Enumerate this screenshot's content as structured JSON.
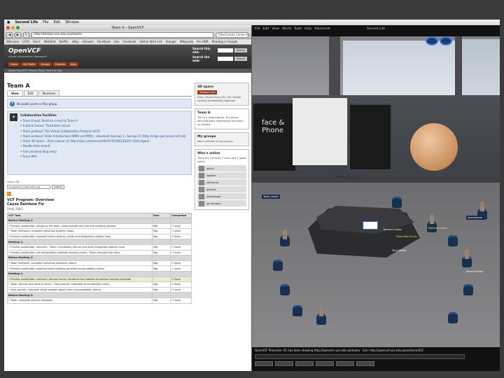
{
  "mac_menu": {
    "app": "Second Life",
    "items": [
      "File",
      "Edit",
      "Window"
    ]
  },
  "browser": {
    "title": "Team A - OpenVCF",
    "url": "http://telstar.ucs.edu.au/team/...",
    "search": "Vital Events Center for iPhoto",
    "bookmarks": [
      "Welcome",
      "LSTA",
      "Sonic",
      "WebStat",
      "Netflix",
      "eBay",
      "Amazon",
      "FaceBook",
      "Zoo",
      "Facebook",
      "Add to Wish List",
      "iGoogle",
      "Wikipedia",
      "Pro HDR",
      "Reading in Google"
    ]
  },
  "site": {
    "logo": "OpenVCF",
    "logo_sub": "virtual collaboration framework",
    "search_site_label": "Search this site:",
    "search_web_label": "Search the web:",
    "search_button": "Search",
    "nav": [
      "Home",
      "My Profile",
      "Groups",
      "Projects",
      "Help"
    ],
    "breadcrumb": "About OpenVCF   Privacy Policy   Terms of Use"
  },
  "page": {
    "title": "Team A",
    "tabs": [
      "View",
      "Edit",
      "Revisions"
    ],
    "notice": "No public posts in this group.",
    "tools_title": "Collaboration Facilities",
    "tools": [
      "Team E-mail: Send an e-mail to Team A",
      "Cultural Issues: Translation Issues",
      "Team protocol: The Virtual Collaboration Protocol (VCP)",
      "Team protocol: Video Introduction (WMV and MP4) - download (backup 1 , backup 2) (http://origin-ger-server.vcf.net)",
      "Team 3D Space - Zone (owner id: http://slurl.com/secondlife/VCF/128/128/25) (Visit Again)",
      "Doodle Polls (meet)",
      "Fast personal blog entry",
      "Team Wiki"
    ],
    "attach_label": "Attach file",
    "attach_value": "Unregistered collaboration.jpg",
    "attach_button": "Submit",
    "program_title": "VCF Program: Overview",
    "program_subtitle": "Cause Rainbow Fix",
    "program_link": "[Help, Edit]",
    "table_headers": [
      "VCF Task",
      "Role",
      "Completed"
    ],
    "rows": [
      {
        "type": "section",
        "task": "Before Meeting 1:",
        "role": "",
        "done": ""
      },
      {
        "type": "row",
        "task": "• Process coordinator: Introduce the team, communicate and plan the meeting process",
        "role": "Mgr",
        "done": "☐ done"
      },
      {
        "type": "row",
        "task": "• Team members: complete individual problem maps",
        "role": "Mgr",
        "done": "☐ done"
      },
      {
        "type": "row",
        "task": "• Process coordinator: organize team meeting; create and integrated problem map",
        "role": "Mgr",
        "done": "☐ done"
      },
      {
        "type": "section",
        "task": "Meeting 1:",
        "role": "",
        "done": ""
      },
      {
        "type": "row",
        "task": "• Process coordinator: welcome · Team: individually discuss and write integrated problem map",
        "role": "Mgr",
        "done": "☐ done"
      },
      {
        "type": "row",
        "task": "• Process coordinator: set deliverables; establish process norms · Team: allocate task roles",
        "role": "Mgr",
        "done": "☐ done"
      },
      {
        "type": "section",
        "task": "Before Meeting 2:",
        "role": "",
        "done": ""
      },
      {
        "type": "row",
        "task": "• Team members: complete individual tolerance matrix",
        "role": "Mgr",
        "done": "☐ done"
      },
      {
        "type": "row",
        "task": "• Process coordinator: organize team meeting; generate accountability matrix",
        "role": "Mgr",
        "done": "☐ done"
      },
      {
        "type": "section",
        "task": "Meeting 2:",
        "role": "",
        "done": ""
      },
      {
        "type": "hl",
        "task": "• Process coordinator: welcome; discuss norms; introduce the problem dimension solution template",
        "role": "-",
        "done": "☐ done"
      },
      {
        "type": "row",
        "task": "• Team: discuss and come to terms · Goal planner: complete accountability matrix",
        "role": "Mgr",
        "done": "☐ done"
      },
      {
        "type": "row",
        "task": "• Goal planner: complete single solution paper (from accountability matrix)",
        "role": "Mgr",
        "done": "☐ done"
      },
      {
        "type": "section",
        "task": "Before Meeting 3:",
        "role": "",
        "done": ""
      },
      {
        "type": "row",
        "task": "• Team: complete solution template",
        "role": "Mgr",
        "done": "☐ done"
      }
    ]
  },
  "sidebar": {
    "space_title": "3D space",
    "space_button": "Teleport now",
    "space_text": "Enter Virtual Zone (2D / 3D / Avatar lockers) (embedded) (optional)",
    "team_title": "Team A",
    "team_text": "This is a closed group. The group administrators add/remove members as needed.",
    "groups_title": "My groups",
    "groups_text": "Not a member of any groups.",
    "online_title": "Who's online",
    "online_text": "There are currently 2 users and 1 guest online.",
    "online_users": [
      "admin",
      "speaker",
      "edthomas",
      "anonym",
      "jhermanger",
      "Jan Burgess"
    ]
  },
  "sl": {
    "menu": [
      "File",
      "Edit",
      "View",
      "World",
      "Tools",
      "Help",
      "Advanced"
    ],
    "title": "Second Life",
    "screen_text": "face & Phone",
    "board_title": "Problem Dimension 01",
    "chat_line": "OpenVCF Presenter #1 has been showing http://opensim.ucs.edu.au/team/ . Sim: http://openvcf.ucs.edu.au/vcfzone/VCF",
    "labels": [
      "Team Ursula",
      "Matthew Dykes",
      "Johnson Collier",
      "Team Bear Grylls",
      "anonymous",
      "Tony Walker",
      "Roland Dykes"
    ]
  }
}
